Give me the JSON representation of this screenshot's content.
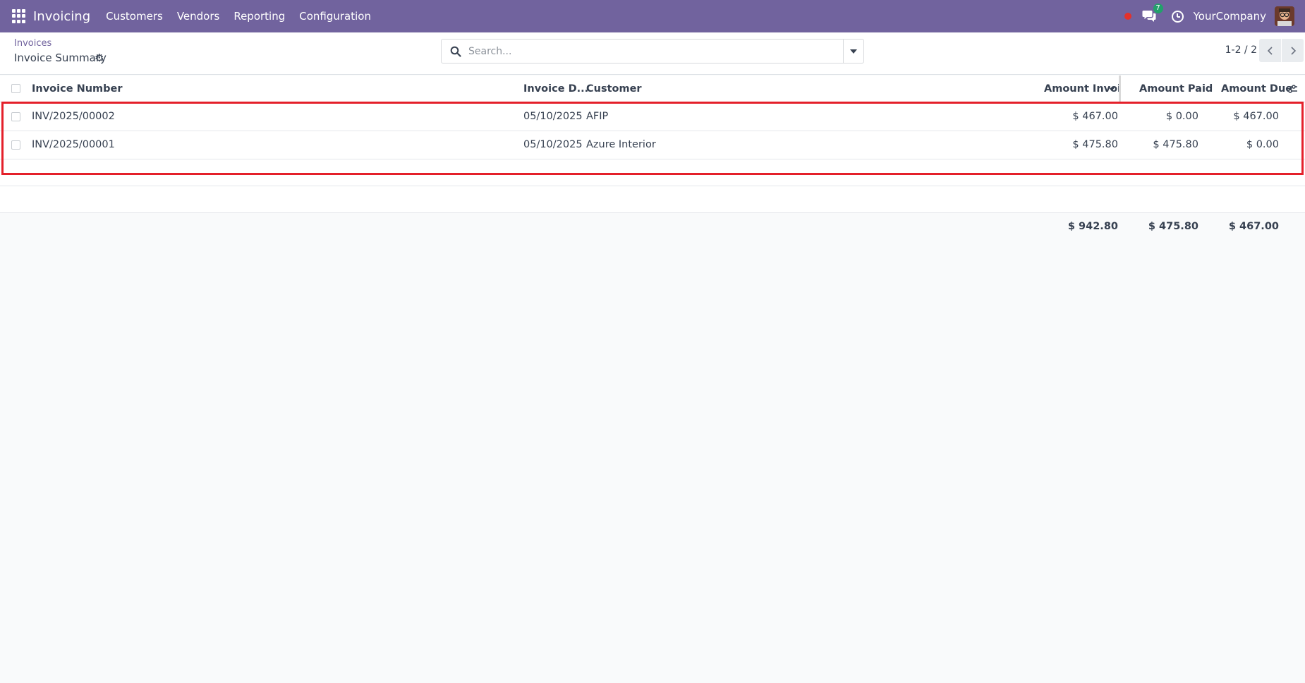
{
  "navbar": {
    "brand": "Invoicing",
    "menu": [
      "Customers",
      "Vendors",
      "Reporting",
      "Configuration"
    ],
    "chat_count": "7",
    "company": "YourCompany",
    "colors": {
      "navbar": "#71639e",
      "record_dot": "#e4312b",
      "badge": "#22a06b"
    }
  },
  "control_panel": {
    "breadcrumb": "Invoices",
    "title": "Invoice Summary",
    "search_placeholder": "Search...",
    "pager": "1-2 / 2"
  },
  "table": {
    "columns": {
      "number": "Invoice Number",
      "date": "Invoice D...",
      "customer": "Customer",
      "amount_invoiced": "Amount Invoi",
      "amount_paid": "Amount Paid",
      "amount_due": "Amount Due"
    },
    "rows": [
      {
        "number": "INV/2025/00002",
        "date": "05/10/2025",
        "customer": "AFIP",
        "amount_invoiced": "$ 467.00",
        "amount_paid": "$ 0.00",
        "amount_due": "$ 467.00"
      },
      {
        "number": "INV/2025/00001",
        "date": "05/10/2025",
        "customer": "Azure Interior",
        "amount_invoiced": "$ 475.80",
        "amount_paid": "$ 475.80",
        "amount_due": "$ 0.00"
      }
    ],
    "totals": {
      "amount_invoiced": "$ 942.80",
      "amount_paid": "$ 475.80",
      "amount_due": "$ 467.00"
    }
  }
}
